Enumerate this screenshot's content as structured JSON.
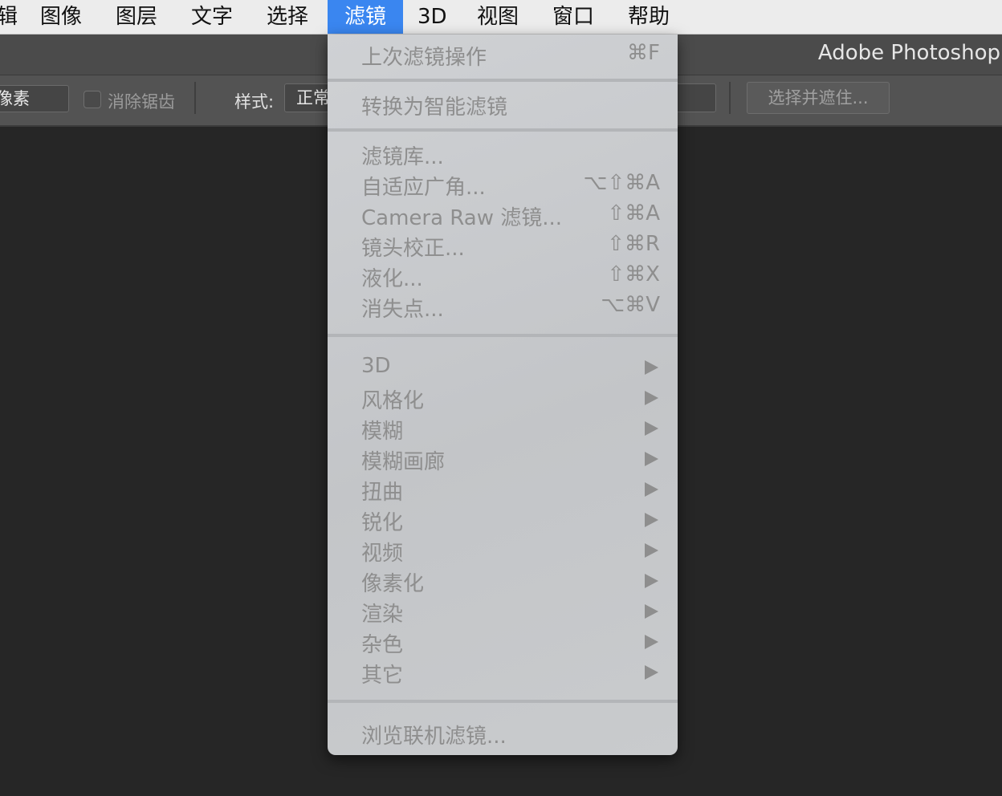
{
  "menubar": {
    "items": [
      {
        "label": "辑"
      },
      {
        "label": "图像"
      },
      {
        "label": "图层"
      },
      {
        "label": "文字"
      },
      {
        "label": "选择"
      },
      {
        "label": "滤镜"
      },
      {
        "label": "3D"
      },
      {
        "label": "视图"
      },
      {
        "label": "窗口"
      },
      {
        "label": "帮助"
      }
    ],
    "active_index": 5
  },
  "titlebar": {
    "title": "Adobe Photoshop"
  },
  "options": {
    "feather_field_value": "像素",
    "antialias_label": "消除锯齿",
    "antialias_checked": false,
    "style_label": "样式:",
    "style_value": "正常",
    "select_mask_button": "选择并遮住..."
  },
  "filter_menu": {
    "last_filter": {
      "label": "上次滤镜操作",
      "shortcut": "⌘F"
    },
    "convert_smart": {
      "label": "转换为智能滤镜"
    },
    "gallery": {
      "label": "滤镜库..."
    },
    "adaptive_wide": {
      "label": "自适应广角...",
      "shortcut": "⌥⇧⌘A"
    },
    "camera_raw": {
      "label": "Camera Raw 滤镜...",
      "shortcut": "⇧⌘A"
    },
    "lens_correction": {
      "label": "镜头校正...",
      "shortcut": "⇧⌘R"
    },
    "liquify": {
      "label": "液化...",
      "shortcut": "⇧⌘X"
    },
    "vanishing_point": {
      "label": "消失点...",
      "shortcut": "⌥⌘V"
    },
    "submenus": [
      "3D",
      "风格化",
      "模糊",
      "模糊画廊",
      "扭曲",
      "锐化",
      "视频",
      "像素化",
      "渲染",
      "杂色",
      "其它"
    ],
    "browse_online": {
      "label": "浏览联机滤镜..."
    },
    "all_disabled": true
  },
  "colors": {
    "menu_highlight": "#3a86f0",
    "disabled_text": "#8e8e8e",
    "canvas_bg": "#262626"
  }
}
